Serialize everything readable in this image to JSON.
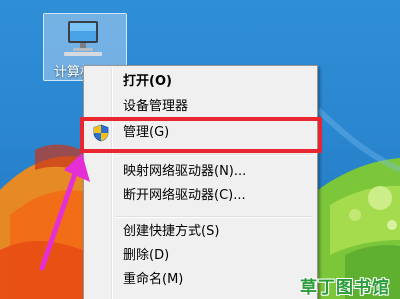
{
  "desktop": {
    "computer_icon": {
      "label": "计算机"
    }
  },
  "context_menu": {
    "items": [
      {
        "label": "打开(O)",
        "bold": true
      },
      {
        "label": "设备管理器"
      },
      {
        "label": "管理(G)",
        "icon": "uac-shield-icon"
      },
      {
        "label": "映射网络驱动器(N)..."
      },
      {
        "label": "断开网络驱动器(C)..."
      },
      {
        "label": "创建快捷方式(S)"
      },
      {
        "label": "删除(D)"
      },
      {
        "label": "重命名(M)"
      }
    ]
  },
  "annotation": {
    "highlight_color": "#e8262f",
    "arrow_color": "#e52fd6"
  },
  "watermark": {
    "text": "草丁图书馆"
  }
}
